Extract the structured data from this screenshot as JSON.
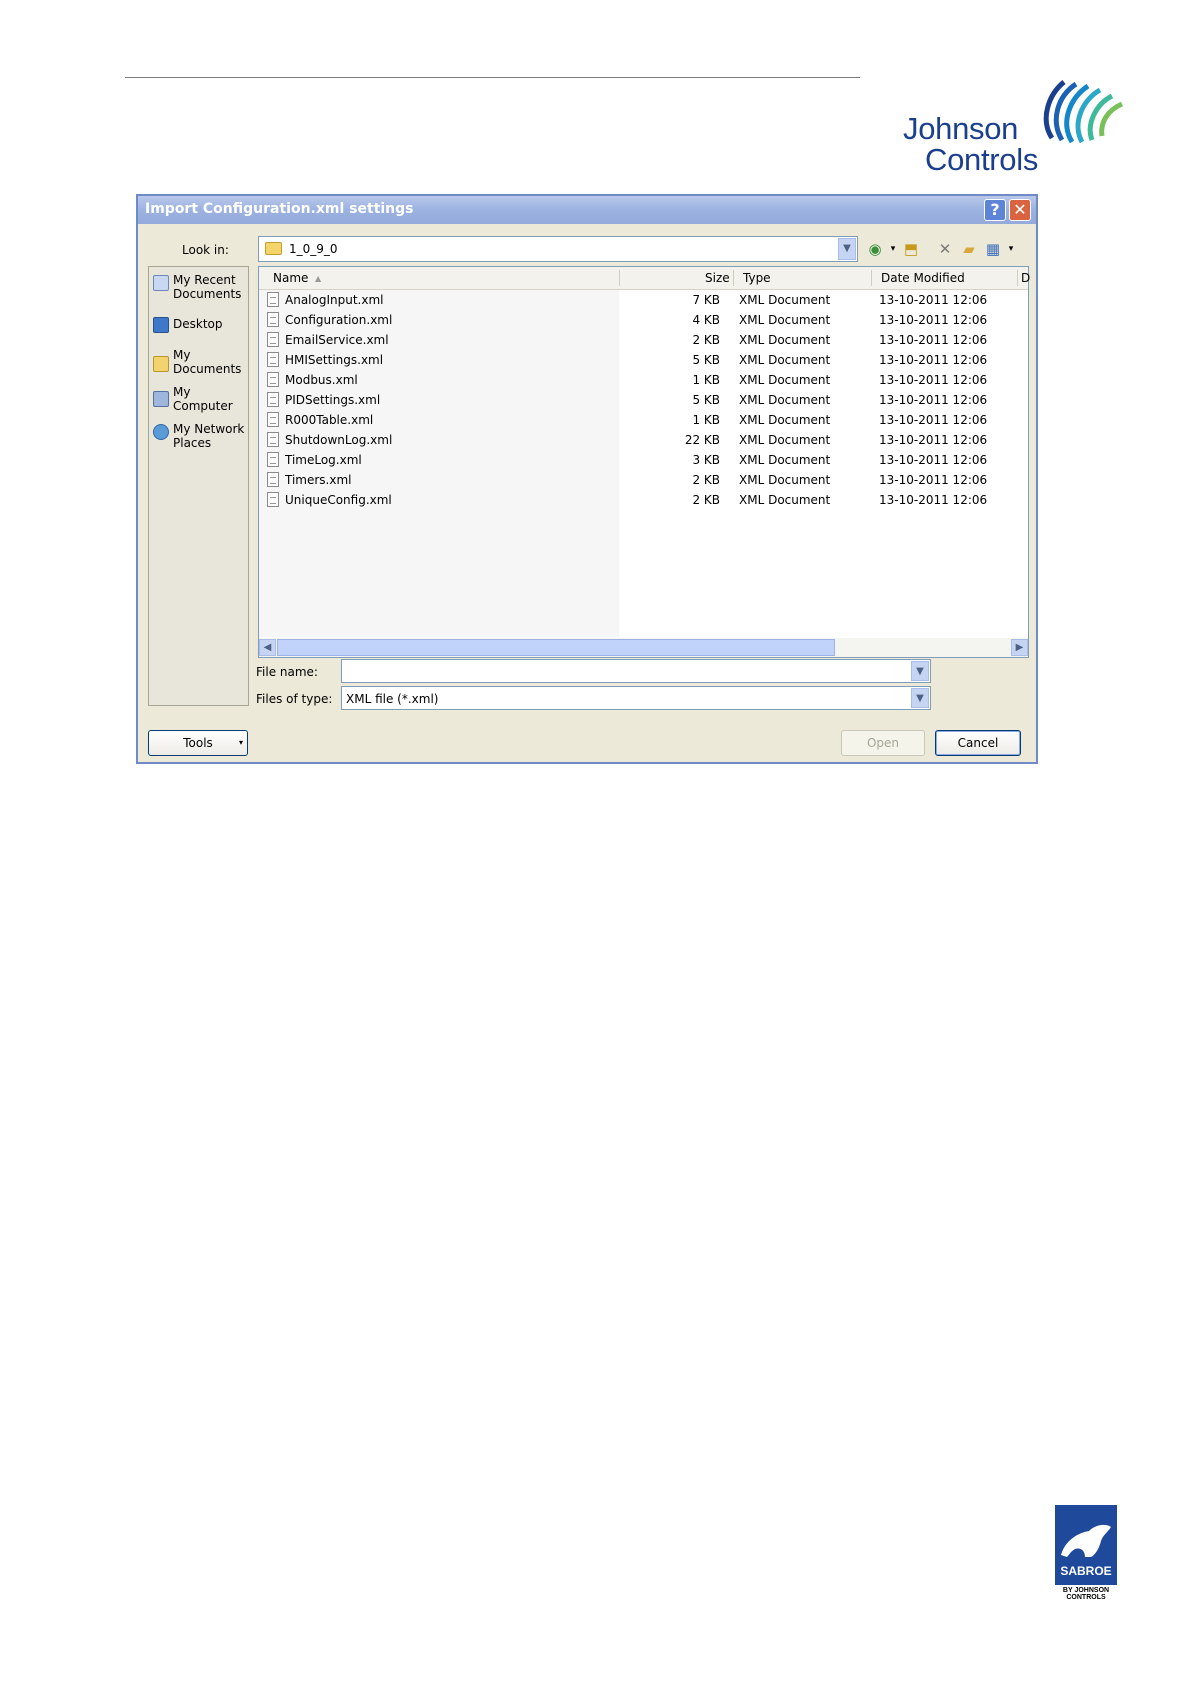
{
  "header_logo": {
    "line1": "Johnson",
    "line2": "Controls"
  },
  "footer_logo": {
    "brand": "SABROE",
    "sub_line1": "BY JOHNSON",
    "sub_line2": "CONTROLS"
  },
  "dialog": {
    "title": "Import Configuration.xml settings",
    "help_label": "?",
    "close_label": "✕",
    "look_in_label": "Look in:",
    "look_in_value": "1_0_9_0",
    "toolbar_icons": [
      "back-icon",
      "up-folder-icon",
      "delete-icon",
      "new-folder-icon",
      "views-icon"
    ],
    "places": [
      {
        "label": "My Recent\nDocuments",
        "icon": "recent-documents-icon"
      },
      {
        "label": "Desktop",
        "icon": "desktop-icon"
      },
      {
        "label": "My\nDocuments",
        "icon": "my-documents-icon"
      },
      {
        "label": "My\nComputer",
        "icon": "my-computer-icon"
      },
      {
        "label": "My Network\nPlaces",
        "icon": "network-places-icon"
      }
    ],
    "columns": {
      "name": "Name",
      "size": "Size",
      "type": "Type",
      "date": "Date Modified",
      "extra": "D"
    },
    "files": [
      {
        "name": "AnalogInput.xml",
        "size": "7 KB",
        "type": "XML Document",
        "date": "13-10-2011 12:06"
      },
      {
        "name": "Configuration.xml",
        "size": "4 KB",
        "type": "XML Document",
        "date": "13-10-2011 12:06"
      },
      {
        "name": "EmailService.xml",
        "size": "2 KB",
        "type": "XML Document",
        "date": "13-10-2011 12:06"
      },
      {
        "name": "HMISettings.xml",
        "size": "5 KB",
        "type": "XML Document",
        "date": "13-10-2011 12:06"
      },
      {
        "name": "Modbus.xml",
        "size": "1 KB",
        "type": "XML Document",
        "date": "13-10-2011 12:06"
      },
      {
        "name": "PIDSettings.xml",
        "size": "5 KB",
        "type": "XML Document",
        "date": "13-10-2011 12:06"
      },
      {
        "name": "R000Table.xml",
        "size": "1 KB",
        "type": "XML Document",
        "date": "13-10-2011 12:06"
      },
      {
        "name": "ShutdownLog.xml",
        "size": "22 KB",
        "type": "XML Document",
        "date": "13-10-2011 12:06"
      },
      {
        "name": "TimeLog.xml",
        "size": "3 KB",
        "type": "XML Document",
        "date": "13-10-2011 12:06"
      },
      {
        "name": "Timers.xml",
        "size": "2 KB",
        "type": "XML Document",
        "date": "13-10-2011 12:06"
      },
      {
        "name": "UniqueConfig.xml",
        "size": "2 KB",
        "type": "XML Document",
        "date": "13-10-2011 12:06"
      }
    ],
    "file_name_label": "File name:",
    "file_name_value": "",
    "files_of_type_label": "Files of type:",
    "files_of_type_value": "XML file (*.xml)",
    "tools_label": "Tools",
    "open_label": "Open",
    "cancel_label": "Cancel"
  }
}
